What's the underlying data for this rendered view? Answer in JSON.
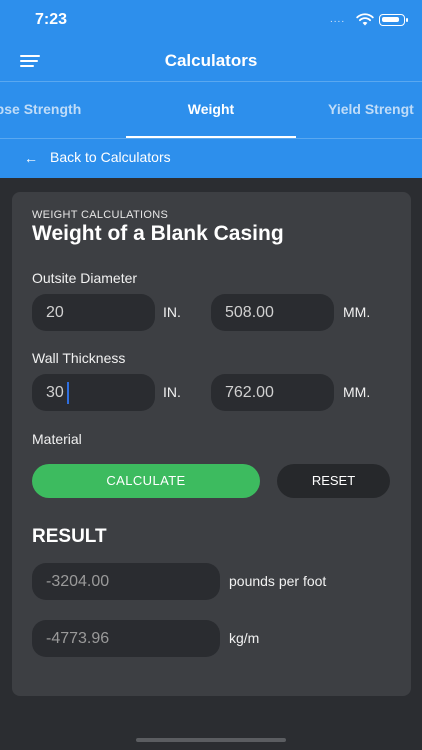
{
  "status_bar": {
    "time": "7:23",
    "signal": "....",
    "icons": [
      "wifi-icon",
      "battery-icon"
    ]
  },
  "header": {
    "title": "Calculators",
    "menu_icon": "hamburger-menu-icon",
    "background_color": "#2d8fec"
  },
  "tabs": [
    {
      "label": "Collapse Strength",
      "visible_text": "lapse Strength",
      "active": false
    },
    {
      "label": "Weight",
      "active": true
    },
    {
      "label": "Yield Strength",
      "visible_text": "Yield Strengt",
      "active": false
    }
  ],
  "back": {
    "label": "Back to Calculators",
    "icon": "arrow-left-icon"
  },
  "card": {
    "kicker": "WEIGHT CALCULATIONS",
    "title": "Weight of a Blank Casing",
    "outside_diameter": {
      "label": "Outsite Diameter",
      "inches": "20",
      "inch_unit": "IN.",
      "millimeters": "508.00",
      "mm_unit": "MM."
    },
    "wall_thickness": {
      "label": "Wall Thickness",
      "inches": "30",
      "inch_unit": "IN.",
      "millimeters": "762.00",
      "mm_unit": "MM."
    },
    "material": {
      "label": "Material"
    },
    "calculate_label": "CALCULATE",
    "reset_label": "RESET",
    "accent_color": "#3dbb5f"
  },
  "result": {
    "heading": "RESULT",
    "imperial": {
      "value": "-3204.00",
      "unit": "pounds per foot"
    },
    "metric": {
      "value": "-4773.96",
      "unit": "kg/m"
    }
  }
}
